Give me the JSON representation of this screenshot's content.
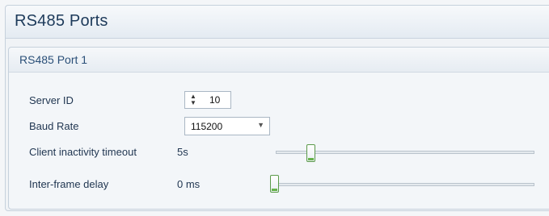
{
  "panel": {
    "title": "RS485 Ports"
  },
  "port": {
    "title": "RS485 Port 1",
    "fields": {
      "server_id": {
        "label": "Server ID",
        "value": "10"
      },
      "baud_rate": {
        "label": "Baud Rate",
        "value": "115200"
      },
      "client_inactivity_timeout": {
        "label": "Client inactivity timeout",
        "value": "5s",
        "slider_fraction": 0.07
      },
      "inter_frame_delay": {
        "label": "Inter-frame delay",
        "value": "0 ms",
        "slider_fraction": 0.0
      }
    }
  },
  "colors": {
    "accent_green": "#66b34a",
    "title_blue": "#1d3a5a"
  }
}
